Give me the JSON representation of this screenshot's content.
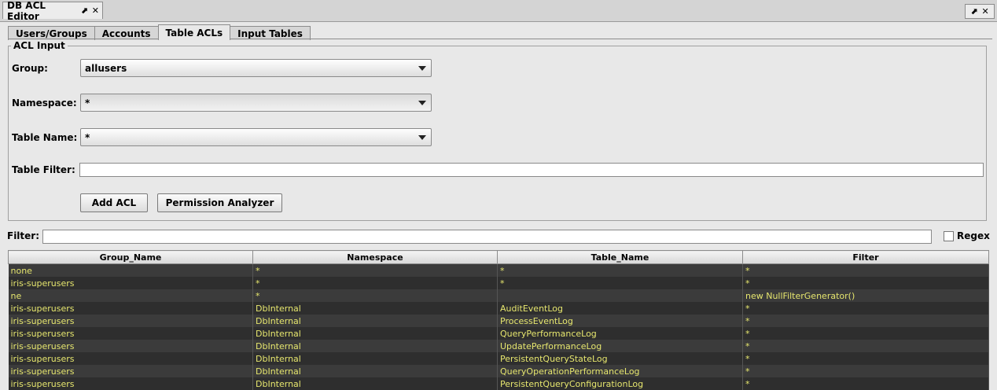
{
  "window": {
    "tab_title": "DB ACL Editor",
    "pin_glyph": "⬈",
    "close_glyph": "✕"
  },
  "tabs": [
    "Users/Groups",
    "Accounts",
    "Table ACLs",
    "Input Tables"
  ],
  "active_tab": "Table ACLs",
  "acl_input": {
    "legend": "ACL Input",
    "group_label": "Group:",
    "group_value": "allusers",
    "namespace_label": "Namespace:",
    "namespace_value": "*",
    "table_name_label": "Table Name:",
    "table_name_value": "*",
    "table_filter_label": "Table Filter:",
    "table_filter_value": "",
    "add_acl_label": "Add ACL",
    "permission_analyzer_label": "Permission Analyzer"
  },
  "filter": {
    "label": "Filter:",
    "value": "",
    "regex_label": "Regex",
    "regex_checked": false
  },
  "table": {
    "columns": [
      "Group_Name",
      "Namespace",
      "Table_Name",
      "Filter"
    ],
    "rows": [
      [
        "none",
        "*",
        "*",
        "*"
      ],
      [
        "iris-superusers",
        "*",
        "*",
        "*"
      ],
      [
        "ne",
        "*",
        "",
        "new NullFilterGenerator()"
      ],
      [
        "iris-superusers",
        "DbInternal",
        "AuditEventLog",
        "*"
      ],
      [
        "iris-superusers",
        "DbInternal",
        "ProcessEventLog",
        "*"
      ],
      [
        "iris-superusers",
        "DbInternal",
        "QueryPerformanceLog",
        "*"
      ],
      [
        "iris-superusers",
        "DbInternal",
        "UpdatePerformanceLog",
        "*"
      ],
      [
        "iris-superusers",
        "DbInternal",
        "PersistentQueryStateLog",
        "*"
      ],
      [
        "iris-superusers",
        "DbInternal",
        "QueryOperationPerformanceLog",
        "*"
      ],
      [
        "iris-superusers",
        "DbInternal",
        "PersistentQueryConfigurationLog",
        "*"
      ]
    ]
  }
}
